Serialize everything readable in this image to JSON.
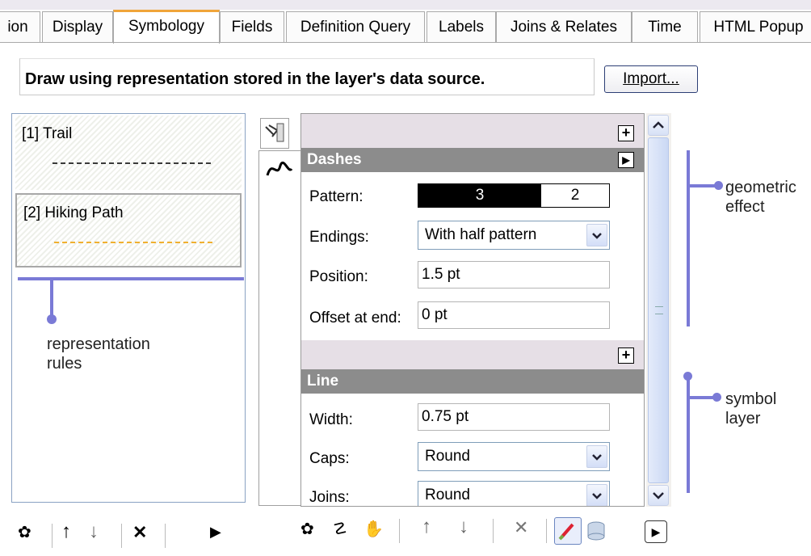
{
  "tabs": [
    "ion",
    "Display",
    "Symbology",
    "Fields",
    "Definition Query",
    "Labels",
    "Joins & Relates",
    "Time",
    "HTML Popup"
  ],
  "active_tab": "Symbology",
  "description": "Draw using representation stored in the layer's data source.",
  "import_button": "Import...",
  "rules": [
    {
      "label": "[1] Trail",
      "line_color": "#3a3a3a"
    },
    {
      "label": "[2] Hiking Path",
      "line_color": "#f0b030"
    }
  ],
  "dashes": {
    "title": "Dashes",
    "pattern_label": "Pattern:",
    "pattern_values": [
      "3",
      "2"
    ],
    "endings_label": "Endings:",
    "endings_value": "With half pattern",
    "position_label": "Position:",
    "position_value": "1.5 pt",
    "offset_label": "Offset at end:",
    "offset_value": "0 pt"
  },
  "line": {
    "title": "Line",
    "width_label": "Width:",
    "width_value": "0.75 pt",
    "caps_label": "Caps:",
    "caps_value": "Round",
    "joins_label": "Joins:",
    "joins_value": "Round"
  },
  "annotations": {
    "geometric": [
      "geometric",
      "effect"
    ],
    "symbol": [
      "symbol",
      "layer"
    ],
    "rules": [
      "representation",
      "rules"
    ]
  },
  "icons": {
    "plus": "+",
    "up": "↑",
    "down": "↓",
    "delete": "✕",
    "expand": "▶"
  },
  "colors": {
    "active_tab": "#f0a53a",
    "section_header": "#8c8c8c",
    "annotation": "#7a7ad6"
  }
}
